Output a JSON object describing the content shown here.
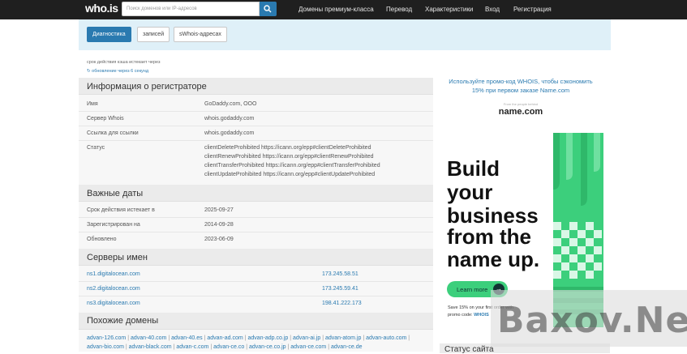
{
  "navbar": {
    "logo": "who.is",
    "search_placeholder": "Поиск доменов или IP-адресов",
    "links": [
      "Домены премиум-класса",
      "Перевод",
      "Характеристики",
      "Вход",
      "Регистрация"
    ]
  },
  "tabs": [
    "Диагностика",
    "записей",
    "sWhois-адресах"
  ],
  "cache": {
    "expire_text": "срок действия кэша истекает через",
    "refresh_text": "обновление через 6 секунд"
  },
  "registrar": {
    "title": "Информация о регистраторе",
    "rows": [
      {
        "label": "Имя",
        "value": "GoDaddy.com, OOO"
      },
      {
        "label": "Сервер Whois",
        "value": "whois.godaddy.com"
      },
      {
        "label": "Ссылка для ссылки",
        "value": "whois.godaddy.com"
      },
      {
        "label": "Статус",
        "value": "clientDeleteProhibited https://icann.org/epp#clientDeleteProhibited"
      }
    ],
    "status_extra": [
      "clientRenewProhibited https://icann.org/epp#clientRenewProhibited",
      "clientTransferProhibited https://icann.org/epp#clientTransferProhibited",
      "clientUpdateProhibited https://icann.org/epp#clientUpdateProhibited"
    ]
  },
  "dates": {
    "title": "Важные даты",
    "rows": [
      {
        "label": "Срок действия истекает в",
        "value": "2025-09-27"
      },
      {
        "label": "Зарегистрирован на",
        "value": "2014-09-28"
      },
      {
        "label": "Обновлено",
        "value": "2023-06-09"
      }
    ]
  },
  "nameservers": {
    "title": "Серверы имен",
    "rows": [
      {
        "host": "ns1.digitalocean.com",
        "ip": "173.245.58.51"
      },
      {
        "host": "ns2.digitalocean.com",
        "ip": "173.245.59.41"
      },
      {
        "host": "ns3.digitalocean.com",
        "ip": "198.41.222.173"
      }
    ]
  },
  "similar": {
    "title": "Похожие домены",
    "domains": [
      "advan-126.com",
      "advan-40.com",
      "advan-40.es",
      "advan-ad.com",
      "advan-adp.co.jp",
      "advan-ai.jp",
      "advan-atom.jp",
      "advan-auto.com",
      "advan-bio.com",
      "advan-black.com",
      "advan-c.com",
      "advan-ce.co",
      "advan-ce.co.jp",
      "advan-ce.com",
      "advan-ce.de"
    ]
  },
  "sidebar": {
    "promo_line1": "Используйте промо-код WHOIS, чтобы сэкономить",
    "promo_line2": "15% при первом заказе Name.com",
    "namecom_small": "From the people behind",
    "namecom_logo": "name.com",
    "ad_lines": [
      "Build",
      "your",
      "business",
      "from the",
      "name up."
    ],
    "learn_more": "Learn more",
    "save_line1": "Save 15% on your first order with",
    "save_line2_prefix": "promo code:",
    "save_code": "WHOIS",
    "site_status_title": "Статус сайта"
  },
  "watermark": "Baxov.Net",
  "colors": {
    "accent": "#2a7ab0",
    "navbar": "#1f1f1f",
    "band": "#dff0f8",
    "ad_green": "#3ccf7c"
  }
}
